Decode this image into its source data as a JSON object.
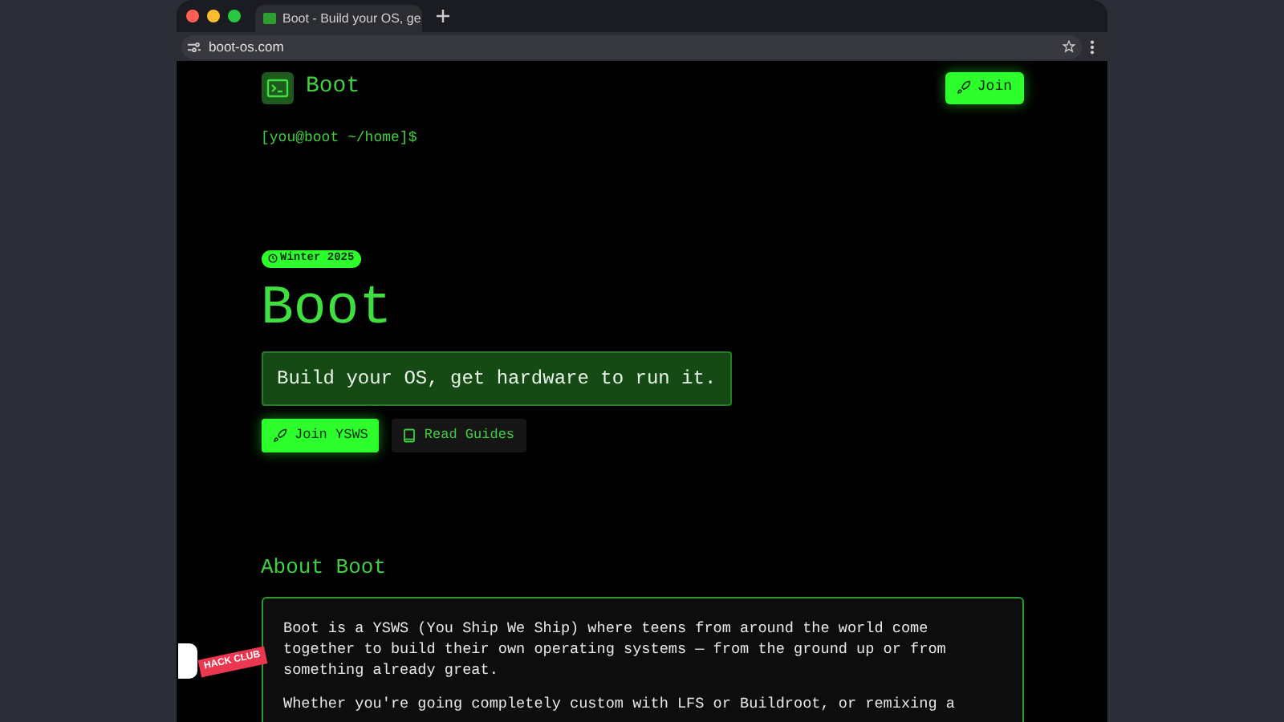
{
  "browser": {
    "tab": {
      "title": "Boot - Build your OS, ge",
      "selected": true
    },
    "address": "boot-os.com"
  },
  "nav": {
    "logo": "Boot",
    "join": "Join"
  },
  "prompt": "[you@boot ~/home]$",
  "hero": {
    "badge": "Winter 2025",
    "title": "Boot",
    "tagline": "Build your OS, get hardware to run it.",
    "buttons": [
      {
        "kind": "primary",
        "label": "Join YSWS"
      },
      {
        "kind": "secondary",
        "label": "Read Guides"
      }
    ]
  },
  "about": {
    "heading": "About Boot",
    "paragraphs": [
      "Boot is a YSWS (You Ship We Ship) where teens from around the world come together to build their own operating systems — from the ground up or from something already great.",
      "Whether you're going completely custom with LFS or Buildroot, or remixing a"
    ]
  },
  "flag": {
    "text": "HACK CLUB"
  }
}
